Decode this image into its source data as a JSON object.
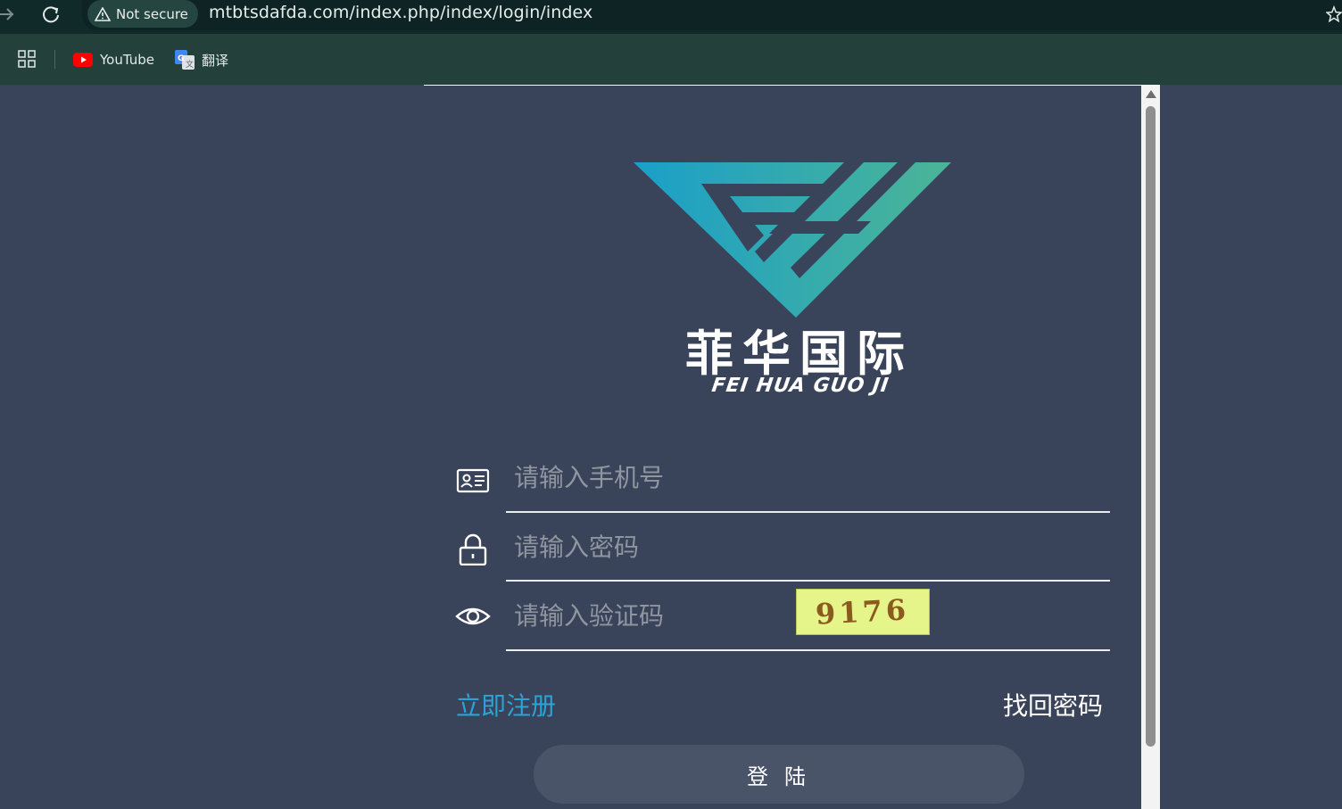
{
  "browser": {
    "security_label": "Not secure",
    "url": "mtbtsdafda.com/index.php/index/login/index",
    "bookmarks": [
      {
        "label": "YouTube",
        "icon": "youtube-icon"
      },
      {
        "label": "翻译",
        "icon": "google-translate-icon"
      }
    ]
  },
  "logo": {
    "cn": "菲华国际",
    "en": "FEI HUA GUO JI",
    "colors": {
      "gradient_start": "#1a9fc9",
      "gradient_end": "#4cb596"
    }
  },
  "form": {
    "phone_placeholder": "请输入手机号",
    "password_placeholder": "请输入密码",
    "captcha_placeholder": "请输入验证码",
    "captcha_code": "9176",
    "register_label": "立即注册",
    "forgot_label": "找回密码",
    "login_label": "登陆"
  },
  "colors": {
    "page_bg": "#394359",
    "link_accent": "#2aa3d8",
    "button_bg": "#4a5469",
    "captcha_bg": "#e6f58a"
  }
}
